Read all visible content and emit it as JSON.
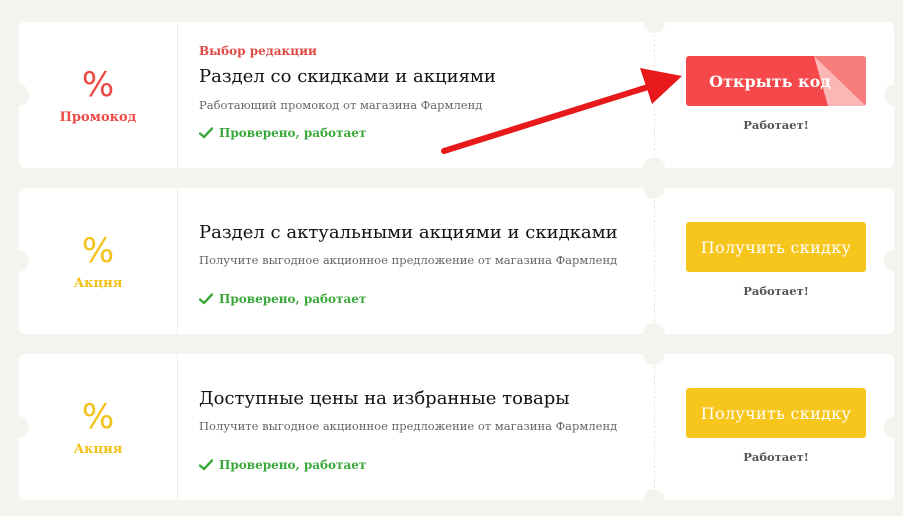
{
  "offers": [
    {
      "type": "Промокод",
      "percent_symbol": "%",
      "editor_choice": "Выбор редакции",
      "title": "Раздел со скидками и акциями",
      "description": "Работающий промокод от магазина Фармленд",
      "verified": "Проверено, работает",
      "button_label": "Открыть код",
      "status": "Работает!",
      "accent": "#ec4a45"
    },
    {
      "type": "Акция",
      "percent_symbol": "%",
      "title": "Раздел с актуальными акциями и скидками",
      "description": "Получите выгодное акционное предложение от магазина Фармленд",
      "verified": "Проверено, работает",
      "button_label": "Получить скидку",
      "status": "Работает!",
      "accent": "#f2c21b"
    },
    {
      "type": "Акция",
      "percent_symbol": "%",
      "title": "Доступные цены на избранные товары",
      "description": "Получите выгодное акционное предложение от магазина Фармленд",
      "verified": "Проверено, работает",
      "button_label": "Получить скидку",
      "status": "Работает!",
      "accent": "#f2c21b"
    }
  ],
  "icons": {
    "check": "check-icon",
    "arrow": "red-arrow-annotation"
  },
  "colors": {
    "promo_red": "#f4484a",
    "deal_yellow": "#f6c61c",
    "verified_green": "#3aa83a",
    "background": "#f5f3ee"
  }
}
